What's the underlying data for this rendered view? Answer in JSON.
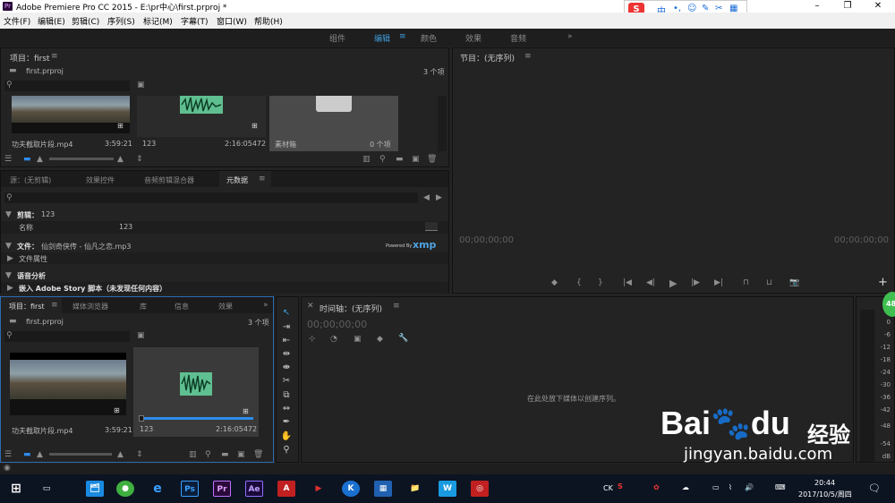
{
  "window": {
    "title": "Adobe Premiere Pro CC 2015 - E:\\pr中心\\first.prproj *",
    "minimize": "–",
    "restore": "❐",
    "close": "✕"
  },
  "menu": [
    "文件(F)",
    "编辑(E)",
    "剪辑(C)",
    "序列(S)",
    "标记(M)",
    "字幕(T)",
    "窗口(W)",
    "帮助(H)"
  ],
  "ime": {
    "logo": "S",
    "mode": "中",
    "items": [
      "•,",
      "☺",
      "✎",
      "✂",
      "🎤",
      "▦"
    ]
  },
  "workspaces": {
    "items": [
      "组件",
      "编辑",
      "颜色",
      "效果",
      "音频"
    ],
    "active": "编辑",
    "menu": "≡",
    "more": "»"
  },
  "project_top": {
    "title": "项目：first",
    "file": "first.prproj",
    "count": "3 个项",
    "items": [
      {
        "name": "功夫截取片段.mp4",
        "duration": "3:59:21"
      },
      {
        "name": "123",
        "duration": "2:16:05472"
      },
      {
        "name": "素材箱",
        "duration": "0 个项"
      }
    ]
  },
  "source_tabs": {
    "items": [
      "源：(无剪辑)",
      "效果控件",
      "音频剪辑混合器",
      "元数据"
    ],
    "active": "元数据"
  },
  "metadata": {
    "clip_label": "剪辑：",
    "clip_value": "123",
    "name_label": "名称",
    "name_value": "123",
    "file_label": "文件：",
    "file_value": "仙剑奇侠传 - 仙凡之恋.mp3",
    "powered_by": "Powered By",
    "xmp": "xmp",
    "file_props": "文件属性",
    "speech": "语音分析",
    "story": "嵌入 Adobe Story 脚本（未发现任何内容）"
  },
  "program": {
    "title": "节目：(无序列)",
    "tc_left": "00;00;00;00",
    "tc_right": "00;00;00;00",
    "controls": [
      "◆",
      "{",
      "}",
      "|◀",
      "◀|",
      "▶",
      "|▶",
      "▶|",
      "⊓",
      "⊔",
      "📷"
    ],
    "add": "+"
  },
  "project_bottom": {
    "tabs": [
      "项目：first",
      "媒体浏览器",
      "库",
      "信息",
      "效果"
    ],
    "active": "项目：first",
    "file": "first.prproj",
    "count": "3 个项",
    "items": [
      {
        "name": "功夫截取片段.mp4",
        "duration": "3:59:21"
      },
      {
        "name": "123",
        "duration": "2:16:05472"
      }
    ]
  },
  "timeline": {
    "title": "时间轴：(无序列)",
    "timecode": "00;00;00;00",
    "hint": "在此处放下媒体以创建序列。"
  },
  "meter": {
    "labels": [
      "0",
      "-6",
      "-12",
      "-18",
      "-24",
      "-30",
      "-36",
      "-42",
      "-48",
      "-54",
      "dB"
    ],
    "badge": "48"
  },
  "taskbar": {
    "start": "⊞",
    "task_view": "▭",
    "apps": [
      "🗂",
      "●",
      "e",
      "Ps",
      "Pr",
      "Ae",
      "A",
      "▶",
      "K",
      "▦",
      "📁",
      "W",
      "◎"
    ],
    "tray_lang": "CK",
    "time": "20:44",
    "date": "2017/10/5/周四"
  },
  "watermark": {
    "brand": "Bai",
    "brand2": "du",
    "cn": "经验",
    "url": "jingyan.baidu.com"
  },
  "colors": {
    "accent": "#3d9bd9",
    "bg": "#232323",
    "wave": "#5fbf90",
    "badge": "#3fbf4f"
  }
}
